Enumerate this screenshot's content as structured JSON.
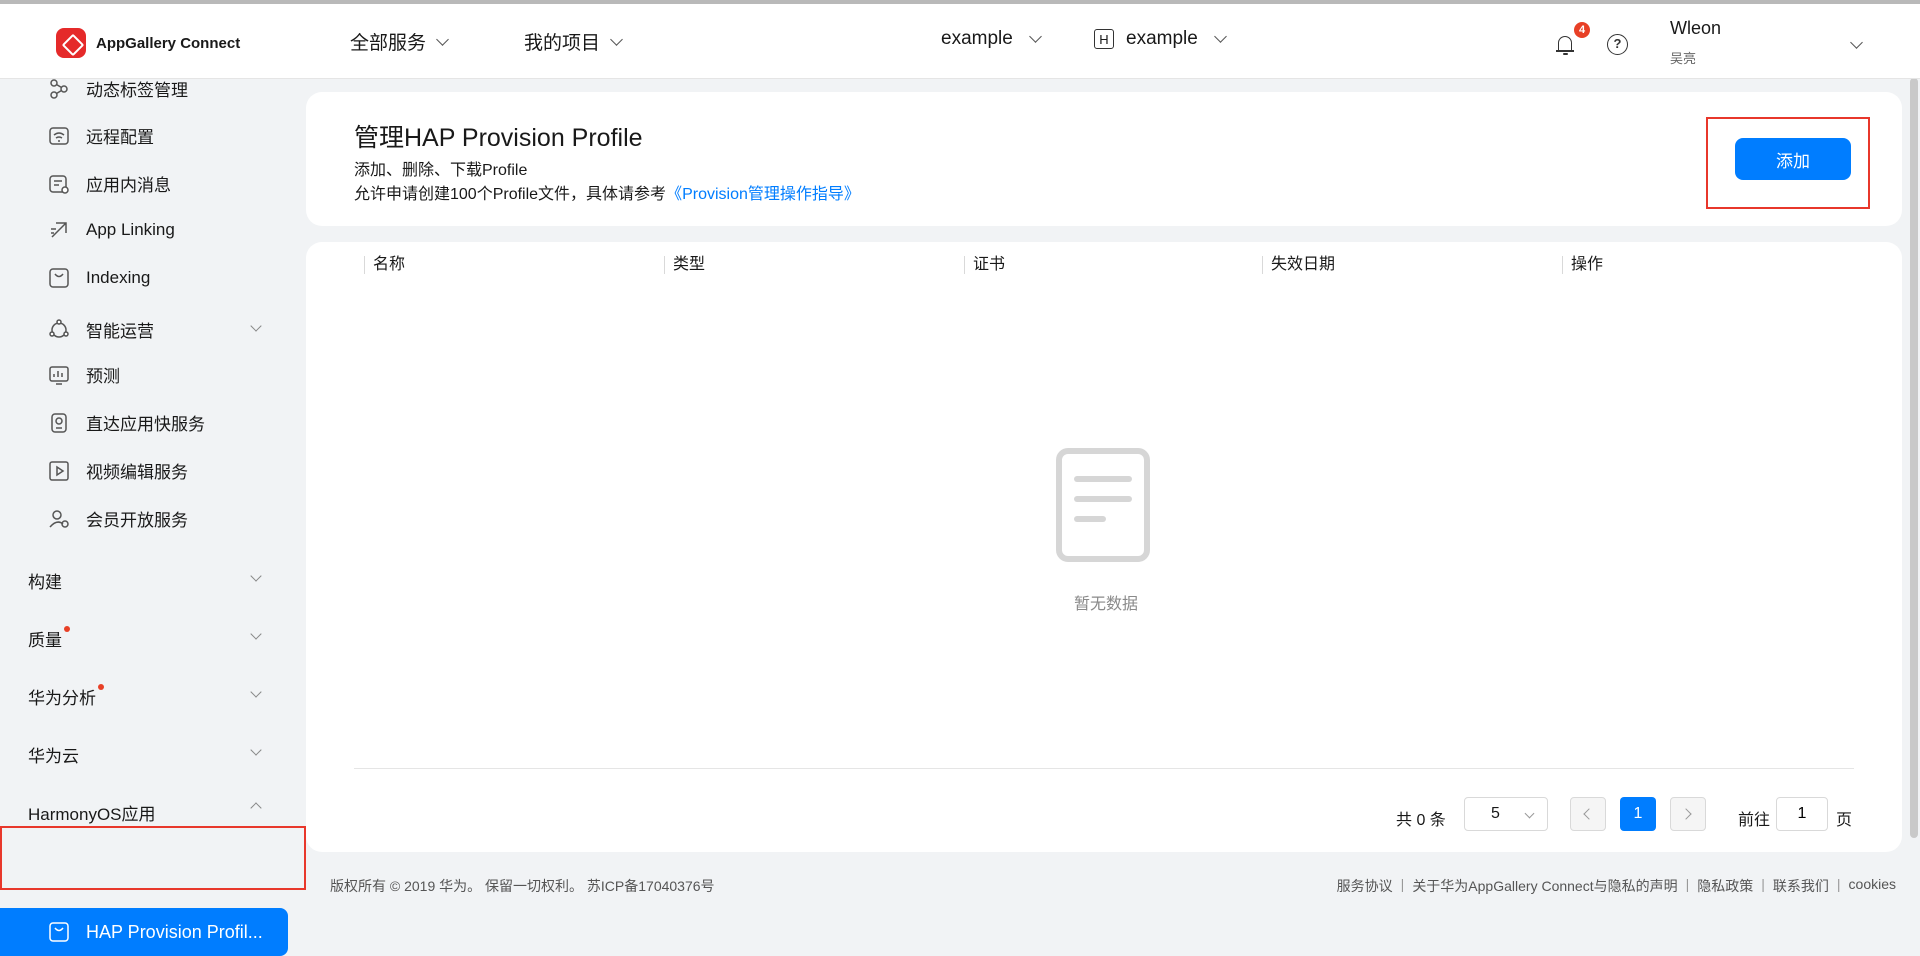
{
  "header": {
    "logo_text": "AppGallery Connect",
    "all_services": "全部服务",
    "my_projects": "我的项目",
    "project": "example",
    "app_badge": "H",
    "app": "example",
    "notifications_count": "4",
    "help_glyph": "?",
    "user_name": "Wleon",
    "user_sub": "吴亮"
  },
  "sidebar": {
    "items": [
      {
        "label": "动态标签管理",
        "icon": "tag-network-icon"
      },
      {
        "label": "远程配置",
        "icon": "wifi-config-icon"
      },
      {
        "label": "应用内消息",
        "icon": "message-icon"
      },
      {
        "label": "App Linking",
        "icon": "link-icon"
      },
      {
        "label": "Indexing",
        "icon": "index-icon"
      },
      {
        "label": "智能运营",
        "icon": "operations-icon"
      },
      {
        "label": "预测",
        "icon": "prediction-icon"
      },
      {
        "label": "直达应用快服务",
        "icon": "quick-service-icon"
      },
      {
        "label": "视频编辑服务",
        "icon": "video-edit-icon"
      },
      {
        "label": "会员开放服务",
        "icon": "member-icon"
      }
    ],
    "groups": [
      {
        "label": "构建"
      },
      {
        "label": "质量"
      },
      {
        "label": "华为分析"
      },
      {
        "label": "华为云"
      },
      {
        "label": "HarmonyOS应用"
      }
    ],
    "active_item": "HAP Provision Profil..."
  },
  "main": {
    "title": "管理HAP Provision Profile",
    "desc1": "添加、删除、下载Profile",
    "desc2_prefix": "允许申请创建100个Profile文件，具体请参考",
    "desc2_link": "《Provision管理操作指导》",
    "add_button": "添加",
    "table_headers": [
      "名称",
      "类型",
      "证书",
      "失效日期",
      "操作"
    ],
    "empty_text": "暂无数据",
    "pagination": {
      "total": "共 0 条",
      "page_size": "5",
      "current_page": "1",
      "goto_label": "前往",
      "goto_value": "1",
      "page_label": "页"
    }
  },
  "footer": {
    "copyright": "版权所有 © 2019 华为。 保留一切权利。 苏ICP备17040376号",
    "links": [
      "服务协议",
      "关于华为AppGallery Connect与隐私的声明",
      "隐私政策",
      "联系我们",
      "cookies"
    ]
  },
  "colors": {
    "accent": "#007dff",
    "highlight": "#e8372b",
    "badge": "#e84026"
  }
}
